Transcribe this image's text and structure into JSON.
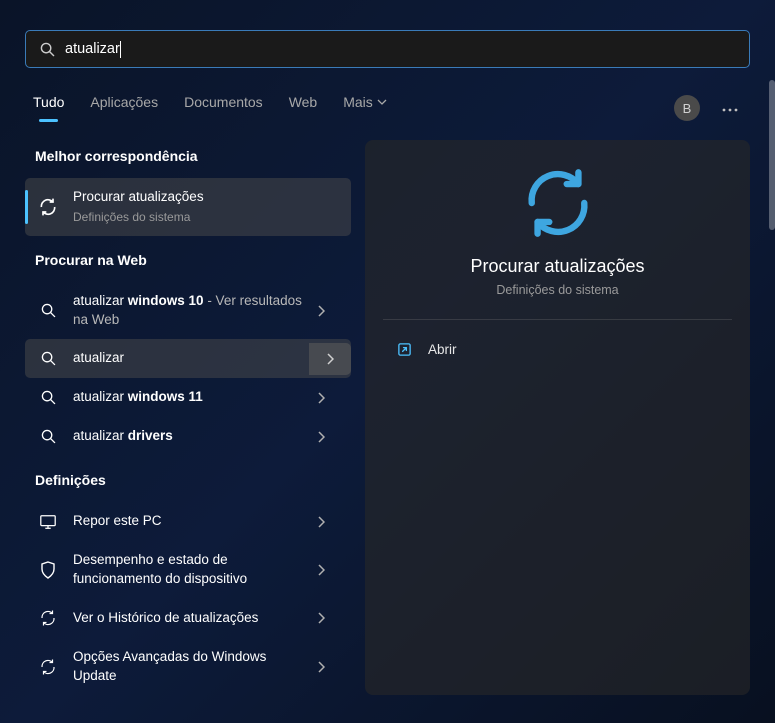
{
  "search": {
    "value": "atualizar"
  },
  "tabs": {
    "all": "Tudo",
    "apps": "Aplicações",
    "docs": "Documentos",
    "web": "Web",
    "more": "Mais"
  },
  "avatar": "B",
  "sections": {
    "best_match": "Melhor correspondência",
    "web": "Procurar na Web",
    "settings": "Definições"
  },
  "best_match_item": {
    "title": "Procurar atualizações",
    "subtitle": "Definições do sistema"
  },
  "web_items": [
    {
      "prefix": "atualizar ",
      "bold": "windows 10",
      "suffix": " - Ver resultados na Web"
    },
    {
      "prefix": "atualizar",
      "bold": "",
      "suffix": ""
    },
    {
      "prefix": "atualizar ",
      "bold": "windows 11",
      "suffix": ""
    },
    {
      "prefix": "atualizar ",
      "bold": "drivers",
      "suffix": ""
    }
  ],
  "settings_items": [
    "Repor este PC",
    "Desempenho e estado de funcionamento do dispositivo",
    "Ver o Histórico de atualizações",
    "Opções Avançadas do Windows Update"
  ],
  "preview": {
    "title": "Procurar atualizações",
    "subtitle": "Definições do sistema",
    "action": "Abrir"
  }
}
